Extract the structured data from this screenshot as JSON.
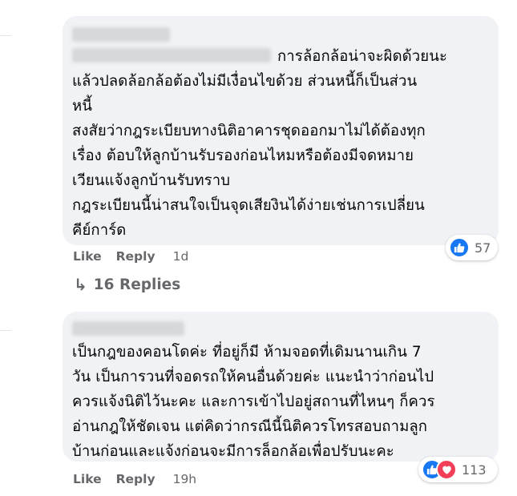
{
  "comment1": {
    "text_lines": [
      "การล้อกล้อน่าจะผิดด้วยนะ",
      "แล้วปลดล้อกล้อต้องไม่มีเงื่อนไขด้วย ส่วนหนี้ก็เป็นส่วน",
      "หนี้",
      "สงสัยว่ากฎระเบียบทางนิติอาคารชุดออกมาไม่ได้ต้องทุก",
      "เรื่อง ต้อบให้ลูกบ้านรับรองก่อนไหมหรือต้องมีจดหมาย",
      "เวียนแจ้งลูกบ้านรับทราบ",
      "กฎระเบียนนี้น่าสนใจเป็นจุดเสียงินได้ง่ายเช่นการเปลี่ยน",
      "คีย์การ์ด"
    ],
    "reaction_count": "57",
    "like_label": "Like",
    "reply_label": "Reply",
    "time": "1d"
  },
  "replies_link": {
    "arrow": "↳",
    "label": "16 Replies"
  },
  "comment2": {
    "text_lines": [
      "เป็นกฎของคอนโดค่ะ ที่อยู่ก็มี ห้ามจอดที่เดิมนานเกิน 7",
      "วัน เป็นการวนที่จอดรถให้คนอื่นด้วยค่ะ แนะนำว่าก่อนไป",
      "ควรแจ้งนิติไว้นะคะ และการเข้าไปอยู่สถานที่ไหนๆ ก็ควร",
      "อ่านกฎให้ชัดเจน แต่คิดว่ากรณีนี้นิติควรโทรสอบถามลูก",
      "บ้านก่อนและแจ้งก่อนจะมีการล็อกล้อเพื่อปรับนะคะ"
    ],
    "reaction_count": "113",
    "like_label": "Like",
    "reply_label": "Reply",
    "time": "19h"
  },
  "colors": {
    "bubble": "#f0f2f5",
    "meta": "#65676b",
    "like_blue": "#1877f2",
    "love_red": "#f33e58"
  }
}
